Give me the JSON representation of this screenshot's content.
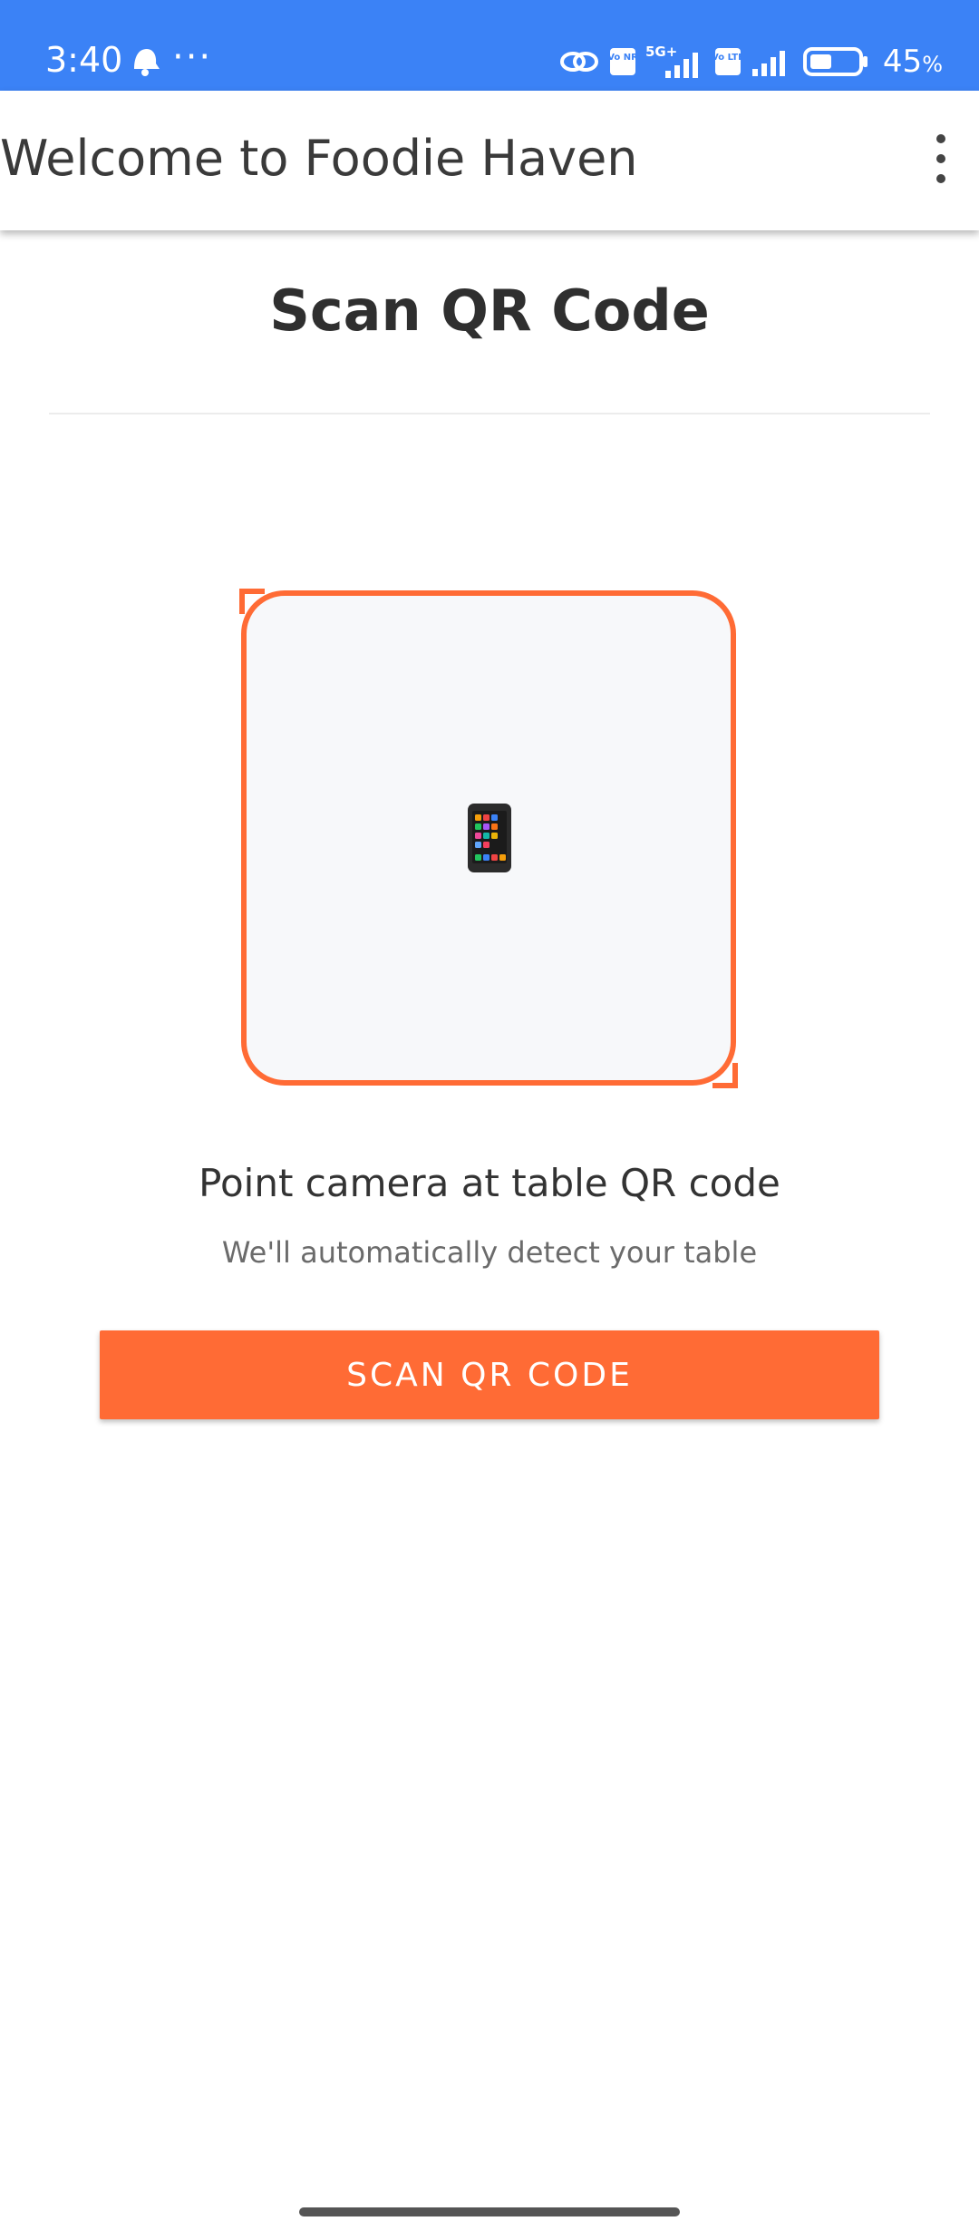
{
  "status_bar": {
    "time": "3:40",
    "more": "···",
    "icons": [
      "bell-icon",
      "link-icon",
      "volte-nr-icon",
      "signal-5g-icon",
      "volte-lte-icon",
      "signal-icon",
      "battery-icon"
    ],
    "network_label": "5G+",
    "vo_nr_label": "Vo NR",
    "vo_lte_label": "Vo LTE",
    "battery_level": 0.45,
    "battery_text": "45",
    "battery_unit": "%"
  },
  "app_bar": {
    "title": "Welcome to Foodie Haven",
    "menu_icon": "more-vert-icon"
  },
  "main": {
    "heading": "Scan QR Code",
    "scanner_icon": "mobile-phone-icon",
    "instruction": "Point camera at table QR code",
    "sub_instruction": "We'll automatically detect your table",
    "scan_button_label": "SCAN QR CODE"
  },
  "colors": {
    "status_bar": "#3b82f6",
    "accent": "#ff6b35",
    "scanner_bg": "#f7f8fa",
    "text_primary": "#2f2f2f",
    "text_secondary": "#6b6b6b"
  }
}
